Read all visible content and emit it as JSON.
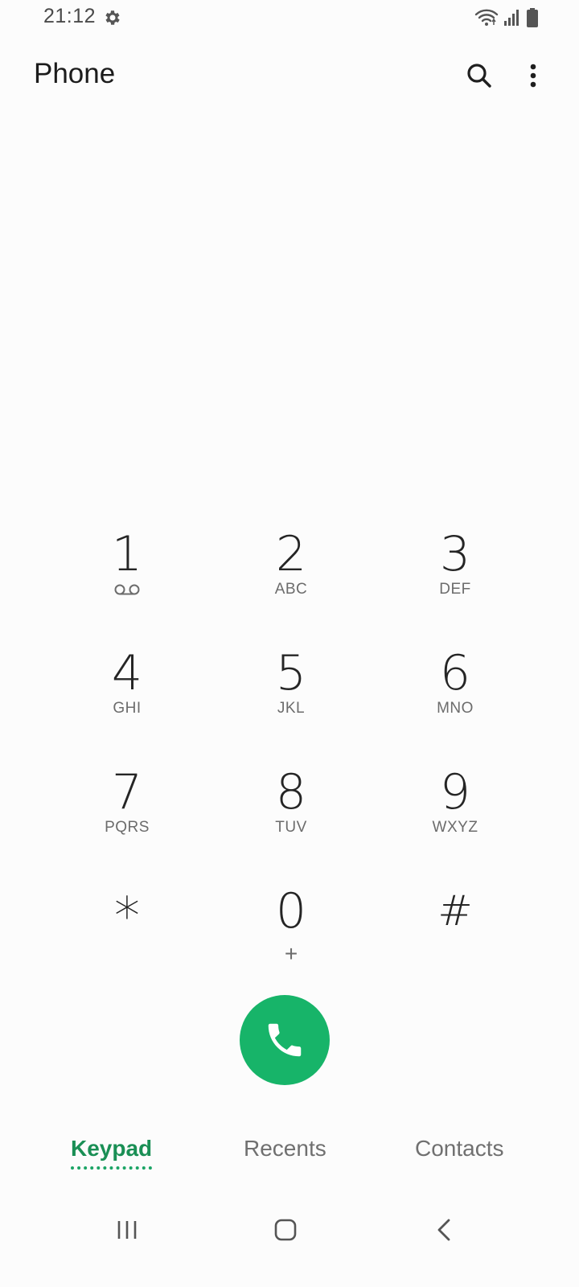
{
  "status_bar": {
    "time": "21:12",
    "icons": [
      "settings-gear-icon",
      "wifi-icon",
      "signal-icon",
      "battery-icon"
    ]
  },
  "app_bar": {
    "title": "Phone",
    "actions": [
      "search-icon",
      "more-options-icon"
    ]
  },
  "keypad": {
    "keys": [
      {
        "digit": "1",
        "sub": "",
        "sub_icon": "voicemail-icon"
      },
      {
        "digit": "2",
        "sub": "ABC"
      },
      {
        "digit": "3",
        "sub": "DEF"
      },
      {
        "digit": "4",
        "sub": "GHI"
      },
      {
        "digit": "5",
        "sub": "JKL"
      },
      {
        "digit": "6",
        "sub": "MNO"
      },
      {
        "digit": "7",
        "sub": "PQRS"
      },
      {
        "digit": "8",
        "sub": "TUV"
      },
      {
        "digit": "9",
        "sub": "WXYZ"
      },
      {
        "digit": "*",
        "sub": ""
      },
      {
        "digit": "0",
        "sub": "+"
      },
      {
        "digit": "#",
        "sub": ""
      }
    ]
  },
  "call_button": {
    "icon": "phone-call-icon",
    "color": "#17B469"
  },
  "tabs": {
    "items": [
      {
        "label": "Keypad",
        "active": true
      },
      {
        "label": "Recents",
        "active": false
      },
      {
        "label": "Contacts",
        "active": false
      }
    ],
    "active_color": "#1A8F55"
  },
  "nav_bar": {
    "buttons": [
      "recent-apps-icon",
      "home-icon",
      "back-icon"
    ]
  }
}
